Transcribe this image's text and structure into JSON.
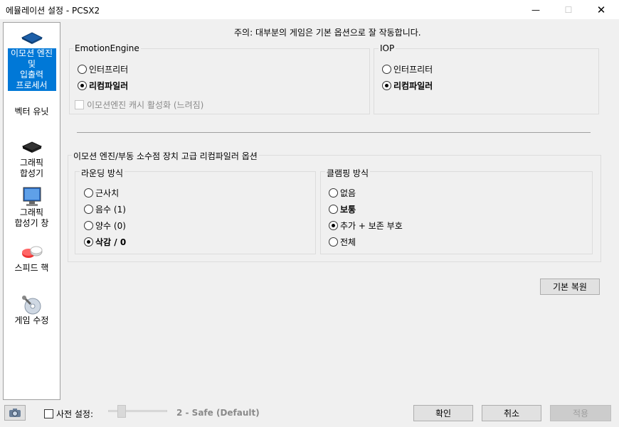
{
  "window": {
    "title": "에뮬레이션 설정 - PCSX2",
    "minimize": "—",
    "maximize": "☐",
    "close": "✕"
  },
  "sidebar": {
    "items": [
      {
        "label": "이모션 엔진 및 입출력 프로세서",
        "lines": [
          "이모션 엔진",
          "및",
          "입출력",
          "프로세서"
        ],
        "icon": "cpu-chip-icon",
        "selected": true
      },
      {
        "label": "벡터 유닛",
        "icon": "vector-unit-icon",
        "selected": false
      },
      {
        "label": "그래픽 합성기",
        "lines": [
          "그래픽",
          "합성기"
        ],
        "icon": "gs-chip-icon",
        "selected": false
      },
      {
        "label": "그래픽 합성기 창",
        "lines": [
          "그래픽",
          "합성기 창"
        ],
        "icon": "monitor-icon",
        "selected": false
      },
      {
        "label": "스피드 핵",
        "icon": "pills-icon",
        "selected": false
      },
      {
        "label": "게임 수정",
        "icon": "disc-wrench-icon",
        "selected": false
      }
    ]
  },
  "notice": "주의: 대부분의 게임은 기본 옵션으로 잘 작동합니다.",
  "ee_group": {
    "title": "EmotionEngine",
    "options": [
      {
        "label": "인터프리터",
        "selected": false
      },
      {
        "label": "리컴파일러",
        "selected": true
      }
    ],
    "cache_checkbox": {
      "label": "이모션엔진 캐시 활성화 (느려짐)",
      "checked": false,
      "disabled": true
    }
  },
  "iop_group": {
    "title": "IOP",
    "options": [
      {
        "label": "인터프리터",
        "selected": false
      },
      {
        "label": "리컴파일러",
        "selected": true
      }
    ]
  },
  "fpu_group": {
    "title": "이모션 엔진/부동 소수점 장치 고급 리컴파일러 옵션",
    "rounding": {
      "title": "라운딩 방식",
      "options": [
        {
          "label": "근사치",
          "selected": false,
          "bold": false
        },
        {
          "label": "음수 (1)",
          "selected": false,
          "bold": false
        },
        {
          "label": "양수 (0)",
          "selected": false,
          "bold": false
        },
        {
          "label": "삭감 / 0",
          "selected": true,
          "bold": true
        }
      ]
    },
    "clamping": {
      "title": "클램핑 방식",
      "options": [
        {
          "label": "없음",
          "selected": false,
          "bold": false
        },
        {
          "label": "보통",
          "selected": false,
          "bold": true
        },
        {
          "label": "추가 + 보존 부호",
          "selected": true,
          "bold": false
        },
        {
          "label": "전체",
          "selected": false,
          "bold": false
        }
      ]
    }
  },
  "restore_defaults_label": "기본 복원",
  "footer": {
    "preset_checkbox_label": "사전 설정:",
    "preset_value_text": "2 - Safe (Default)",
    "preset_level": 2,
    "ok_label": "확인",
    "cancel_label": "취소",
    "apply_label": "적용"
  }
}
